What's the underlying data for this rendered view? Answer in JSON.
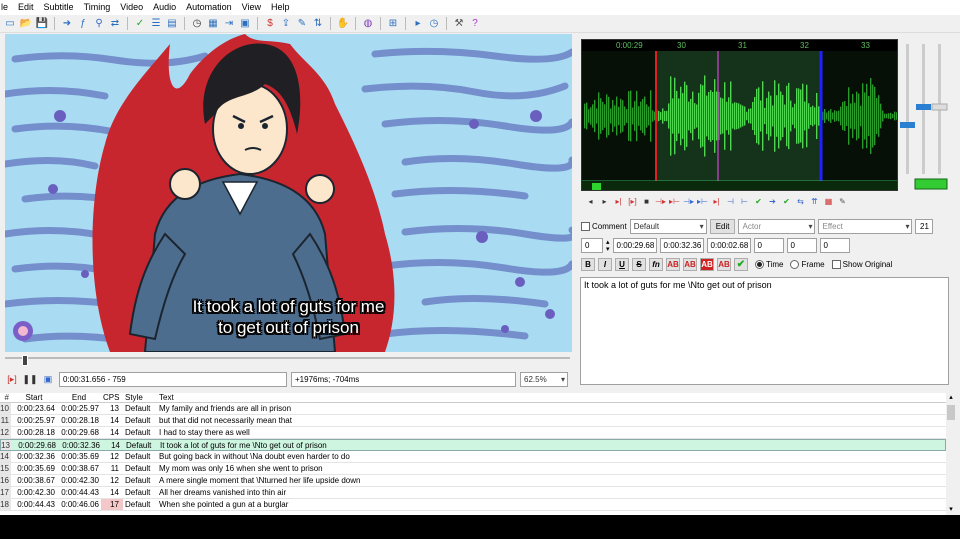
{
  "menu": [
    "le",
    "Edit",
    "Subtitle",
    "Timing",
    "Video",
    "Audio",
    "Automation",
    "View",
    "Help"
  ],
  "toolbar_icons": [
    "new-icon",
    "open-icon",
    "save-icon",
    "sep",
    "attachments-icon",
    "fonts-icon",
    "find-icon",
    "replace-icon",
    "sep",
    "spell-icon",
    "properties-icon",
    "styles-icon",
    "sep",
    "time-icon",
    "resample-icon",
    "shift-icon",
    "select-icon",
    "sep",
    "paste-icon",
    "export-icon",
    "translate-icon",
    "sort-icon",
    "sep",
    "automation-icon",
    "sep",
    "kanji-icon",
    "sep",
    "zoom-icon",
    "sep",
    "fullscreen-icon",
    "timing-icon",
    "sep",
    "settings-icon",
    "help-icon"
  ],
  "video": {
    "subtitle_line1": "It took a lot of guts for me",
    "subtitle_line2": "to get out of prison",
    "time_display": "0:00:31.656 - 759",
    "offset_display": "+1976ms; -704ms",
    "zoom": "62.5%",
    "seek_position": 0.03
  },
  "audio": {
    "ticks": [
      "0:00:29",
      "30",
      "31",
      "32",
      "33"
    ]
  },
  "edit": {
    "comment_label": "Comment",
    "style_value": "Default",
    "edit_button": "Edit",
    "actor_placeholder": "Actor",
    "effect_placeholder": "Effect",
    "char_count": "21",
    "layer": "0",
    "start_time": "0:00:29.68",
    "end_time": "0:00:32.36",
    "duration": "0:00:02.68",
    "margin_l": "0",
    "margin_r": "0",
    "margin_v": "0",
    "fmt_buttons": [
      "B",
      "I",
      "U",
      "S",
      "fn",
      "AB",
      "AB",
      "AB",
      "AB"
    ],
    "time_radio": "Time",
    "frame_radio": "Frame",
    "show_original": "Show Original",
    "text": "It took a lot of guts for me \\Nto get out of prison"
  },
  "grid": {
    "headers": [
      "#",
      "Start",
      "End",
      "CPS",
      "Style",
      "Text"
    ],
    "rows": [
      {
        "num": "10",
        "start": "0:00:23.64",
        "end": "0:00:25.97",
        "cps": "13",
        "style": "Default",
        "text": "My family and friends are all in prison",
        "active": false,
        "warn": false
      },
      {
        "num": "11",
        "start": "0:00:25.97",
        "end": "0:00:28.18",
        "cps": "14",
        "style": "Default",
        "text": "but that did not necessarily mean that",
        "active": false,
        "warn": false
      },
      {
        "num": "12",
        "start": "0:00:28.18",
        "end": "0:00:29.68",
        "cps": "14",
        "style": "Default",
        "text": "I had to stay there as well",
        "active": false,
        "warn": false
      },
      {
        "num": "13",
        "start": "0:00:29.68",
        "end": "0:00:32.36",
        "cps": "14",
        "style": "Default",
        "text": "It took a lot of guts for me \\Nto get out of prison",
        "active": true,
        "warn": false
      },
      {
        "num": "14",
        "start": "0:00:32.36",
        "end": "0:00:35.69",
        "cps": "12",
        "style": "Default",
        "text": "But going back in without \\Na doubt even harder to do",
        "active": false,
        "warn": false
      },
      {
        "num": "15",
        "start": "0:00:35.69",
        "end": "0:00:38.67",
        "cps": "11",
        "style": "Default",
        "text": "My mom was only 16 when she went to prison",
        "active": false,
        "warn": false
      },
      {
        "num": "16",
        "start": "0:00:38.67",
        "end": "0:00:42.30",
        "cps": "12",
        "style": "Default",
        "text": "A mere single moment that \\Nturned her life upside down",
        "active": false,
        "warn": false
      },
      {
        "num": "17",
        "start": "0:00:42.30",
        "end": "0:00:44.43",
        "cps": "14",
        "style": "Default",
        "text": "All her dreams vanished into thin air",
        "active": false,
        "warn": false
      },
      {
        "num": "18",
        "start": "0:00:44.43",
        "end": "0:00:46.06",
        "cps": "17",
        "style": "Default",
        "text": "When she pointed a gun at a burglar",
        "active": false,
        "warn": true
      }
    ]
  }
}
